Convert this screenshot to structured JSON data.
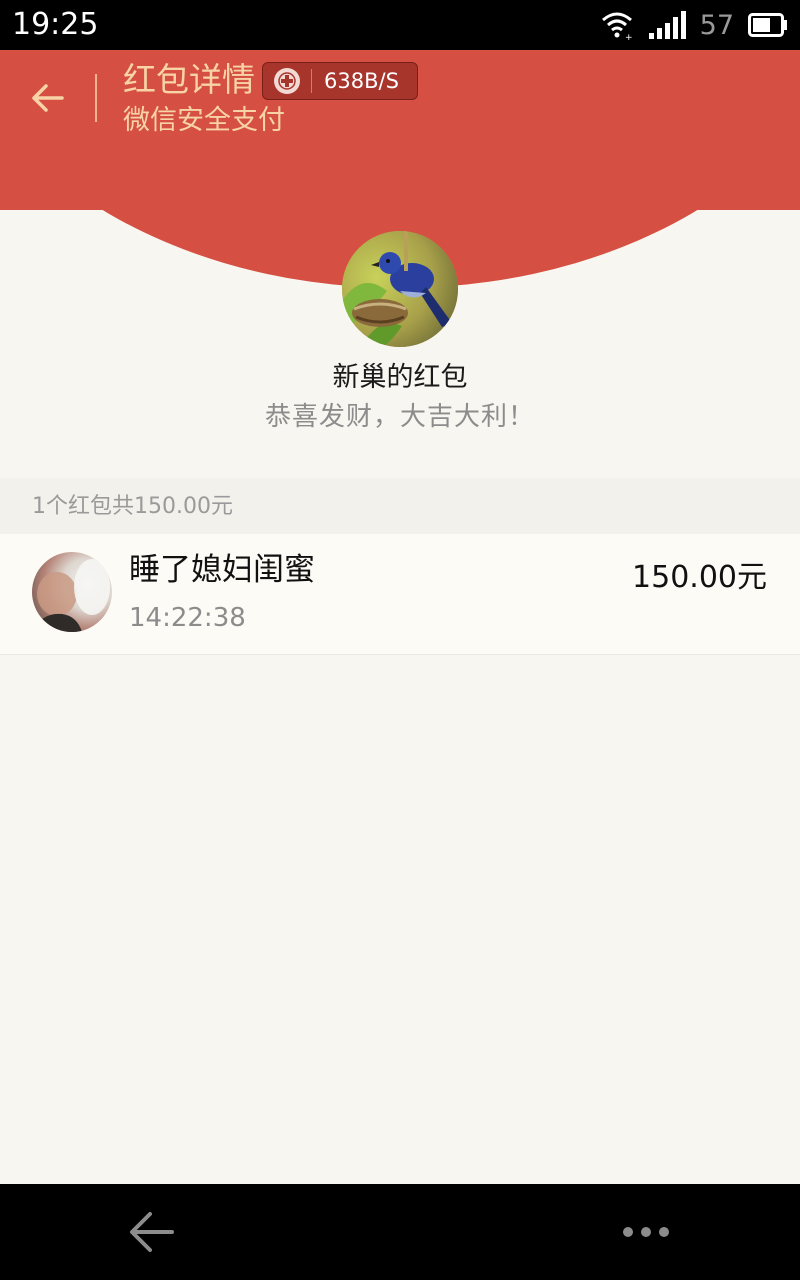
{
  "status_bar": {
    "time": "19:25",
    "battery": "57",
    "icons": [
      "wifi-icon",
      "signal-icon",
      "battery-icon"
    ]
  },
  "header": {
    "title": "红包详情",
    "subtitle": "微信安全支付",
    "back_icon": "arrow-left-icon",
    "network_speed": "638B/S",
    "colors": {
      "background": "#d55043",
      "text": "#f8d3a8"
    }
  },
  "sender": {
    "name": "新巢的红包",
    "wish": "恭喜发财，大吉大利！"
  },
  "summary": {
    "text": "1个红包共150.00元"
  },
  "receivers": [
    {
      "name": "睡了媳妇闺蜜",
      "time": "14:22:38",
      "amount": "150.00元"
    }
  ],
  "nav_bar": {
    "icons": [
      "back-icon",
      "more-icon"
    ]
  }
}
